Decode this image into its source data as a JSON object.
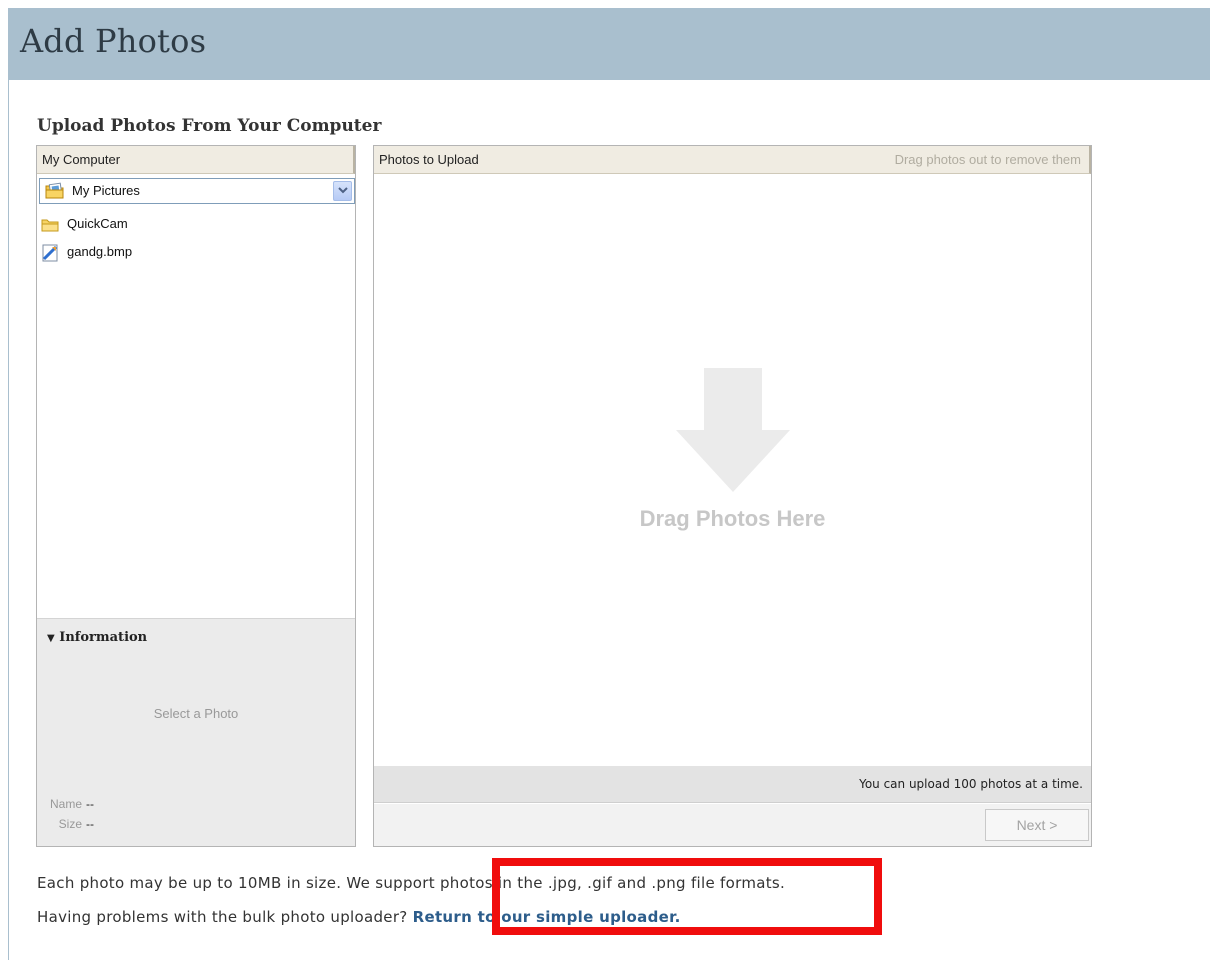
{
  "page": {
    "title": "Add Photos",
    "section_title": "Upload Photos From Your Computer"
  },
  "left_panel": {
    "header": "My Computer",
    "folder_select": {
      "selected": "My Pictures",
      "icon": "pictures-folder-icon"
    },
    "files": [
      {
        "label": "QuickCam",
        "icon": "folder-icon"
      },
      {
        "label": "gandg.bmp",
        "icon": "image-file-icon"
      }
    ],
    "info": {
      "title": "Information",
      "toggle_glyph": "▼",
      "placeholder": "Select a Photo",
      "name_label": "Name",
      "name_value": "--",
      "size_label": "Size",
      "size_value": "--"
    }
  },
  "right_panel": {
    "header": "Photos to Upload",
    "hint": "Drag photos out to remove them",
    "drop_label": "Drag Photos Here",
    "limit_text": "You can upload 100 photos at a time.",
    "next_label": "Next >"
  },
  "notes": {
    "size_info": "Each photo may be up to 10MB in size. We support photos in the .jpg, .gif and .png file formats.",
    "problems_prefix": "Having problems with the bulk photo uploader?",
    "simple_uploader_link": "Return to our simple uploader."
  },
  "colors": {
    "header_bg": "#a9bfce",
    "link": "#2d5d8b",
    "highlight": "#f00d0d"
  }
}
